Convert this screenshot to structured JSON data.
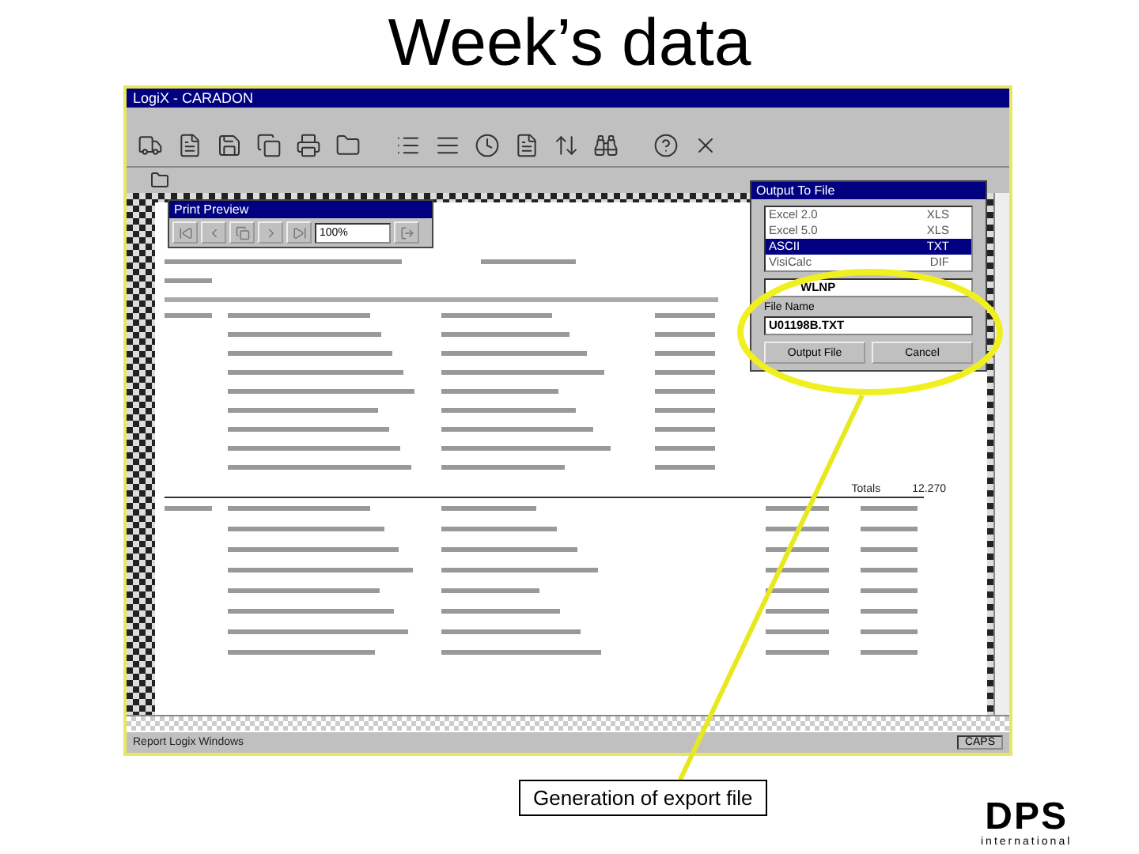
{
  "slide": {
    "title": "Week’s data",
    "caption": "Generation of export file",
    "logo": {
      "name": "DPS",
      "tagline": "international"
    }
  },
  "window": {
    "title": "LogiX - CARADON"
  },
  "print_preview": {
    "title": "Print Preview",
    "zoom": "100%"
  },
  "report": {
    "totals_label": "Totals",
    "totals_value": "12.270"
  },
  "output_dialog": {
    "title": "Output To File",
    "formats": [
      {
        "name": "Excel 2.0",
        "ext": "XLS",
        "selected": false
      },
      {
        "name": "Excel 5.0",
        "ext": "XLS",
        "selected": false
      },
      {
        "name": "ASCII",
        "ext": "TXT",
        "selected": true
      },
      {
        "name": "VisiCalc",
        "ext": "DIF",
        "selected": false
      }
    ],
    "directory": "WLNP",
    "file_name_label": "File Name",
    "file_name": "U01198B.TXT",
    "buttons": [
      "Output File",
      "Cancel"
    ]
  },
  "status_bar": {
    "text": "Report Logix Windows",
    "caps": "CAPS"
  }
}
